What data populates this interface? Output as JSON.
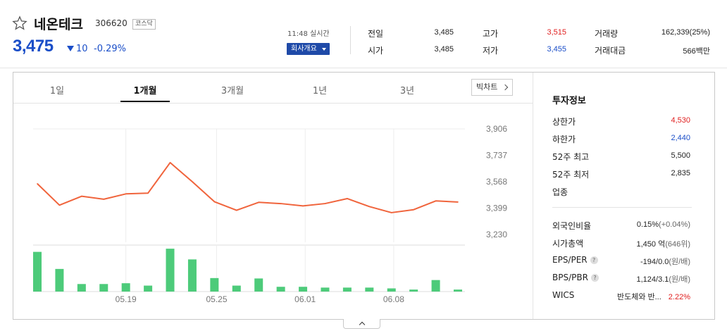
{
  "stock": {
    "name": "네온테크",
    "code": "306620",
    "market": "코스닥",
    "price": "3,475",
    "change": "10",
    "change_pct": "-0.29%",
    "time": "11:48 실시간",
    "company_button": "회사개요"
  },
  "quotes": [
    {
      "label": "전일",
      "value": "3,485",
      "color": "#222222"
    },
    {
      "label": "시가",
      "value": "3,485",
      "color": "#222222"
    },
    {
      "label": "고가",
      "value": "3,515",
      "color": "#e02020"
    },
    {
      "label": "저가",
      "value": "3,455",
      "color": "#1a4ec8"
    },
    {
      "label": "거래량",
      "value": "162,339(25%)",
      "color": "#222222"
    },
    {
      "label": "거래대금",
      "value": "566백만",
      "color": "#222222"
    }
  ],
  "tabs": [
    "1일",
    "1개월",
    "3개월",
    "1년",
    "3년"
  ],
  "active_tab": "1개월",
  "big_chart_button": "빅차트",
  "invest": {
    "title": "투자정보",
    "rows1": [
      {
        "label": "상한가",
        "value": "4,530",
        "color": "#e02020"
      },
      {
        "label": "하한가",
        "value": "2,440",
        "color": "#1a4ec8"
      },
      {
        "label": "52주 최고",
        "value": "5,500",
        "color": "#222222"
      },
      {
        "label": "52주 최저",
        "value": "2,835",
        "color": "#222222"
      },
      {
        "label": "업종",
        "value": "",
        "color": "#222222"
      }
    ],
    "rows2": [
      {
        "label": "외국인비율",
        "value": "0.15%",
        "extra": "(+0.04%)",
        "help": false
      },
      {
        "label": "시가총액",
        "value": "1,450 억",
        "extra": "(646위)",
        "help": false
      },
      {
        "label": "EPS/PER",
        "value": "-194/0.0",
        "extra": "(원/배)",
        "help": true
      },
      {
        "label": "BPS/PBR",
        "value": "1,124/3.1",
        "extra": "(원/배)",
        "help": true
      },
      {
        "label": "WICS",
        "value": "반도체와 반...",
        "extra": "2.22%",
        "help": false
      }
    ]
  },
  "colors": {
    "price_blue": "#1a4ec8",
    "up_red": "#e02020",
    "line": "#f0643c",
    "volume": "#4dcb7a"
  },
  "chart_data": {
    "type": "line",
    "y_ticks": [
      "3,906",
      "3,737",
      "3,568",
      "3,399",
      "3,230"
    ],
    "x_ticks": [
      "05.19",
      "05.25",
      "06.01",
      "06.08"
    ],
    "ylim": [
      3230,
      3906
    ],
    "series": [
      {
        "values": [
          3555,
          3418,
          3475,
          3456,
          3490,
          3495,
          3690,
          3568,
          3440,
          3385,
          3436,
          3428,
          3413,
          3428,
          3460,
          3409,
          3370,
          3389,
          3445,
          3438
        ]
      }
    ],
    "volume": [
      1.0,
      0.57,
      0.19,
      0.19,
      0.21,
      0.15,
      1.08,
      0.81,
      0.34,
      0.15,
      0.33,
      0.12,
      0.12,
      0.1,
      0.1,
      0.1,
      0.08,
      0.05,
      0.29,
      0.05
    ]
  }
}
